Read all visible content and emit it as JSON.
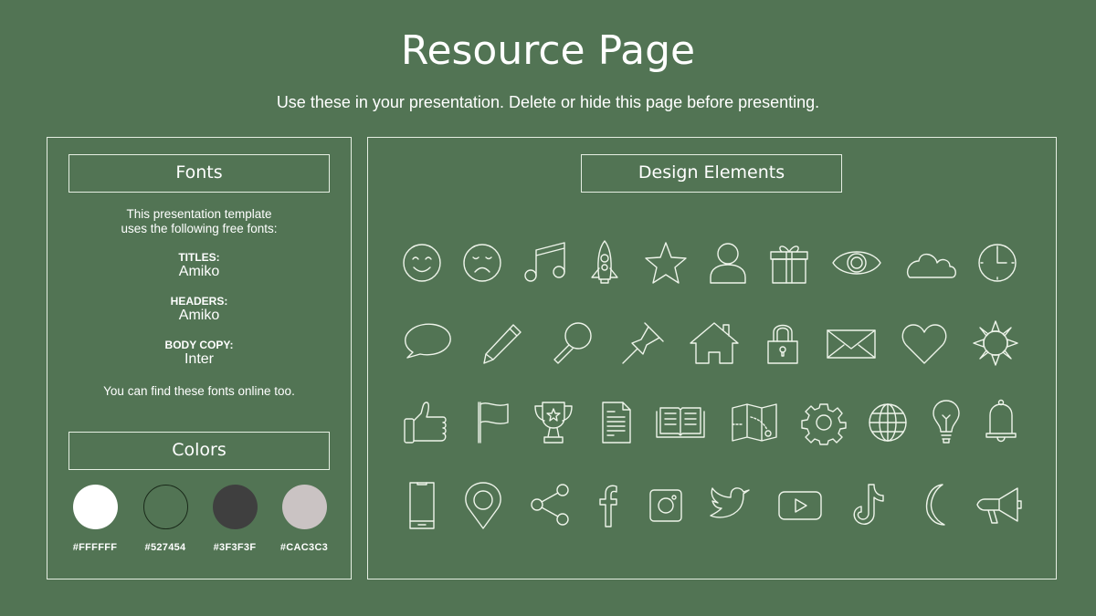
{
  "header": {
    "title": "Resource Page",
    "subtitle": "Use these in your presentation. Delete or hide this page before presenting."
  },
  "fonts_panel": {
    "heading": "Fonts",
    "intro_line1": "This presentation template",
    "intro_line2": "uses the following free fonts:",
    "entries": [
      {
        "label": "TITLES:",
        "value": "Amiko"
      },
      {
        "label": "HEADERS:",
        "value": "Amiko"
      },
      {
        "label": "BODY COPY:",
        "value": "Inter"
      }
    ],
    "footer": "You can find these fonts online too."
  },
  "colors_panel": {
    "heading": "Colors",
    "swatches": [
      {
        "hex": "#FFFFFF",
        "color": "#FFFFFF"
      },
      {
        "hex": "#527454",
        "color": "#527454"
      },
      {
        "hex": "#3F3F3F",
        "color": "#3F3F3F"
      },
      {
        "hex": "#CAC3C3",
        "color": "#CAC3C3"
      }
    ]
  },
  "design_panel": {
    "heading": "Design Elements",
    "icons": [
      [
        "smiley-face",
        "sad-face",
        "music-note",
        "rocket",
        "star",
        "user",
        "gift",
        "eye",
        "cloud",
        "clock"
      ],
      [
        "speech-bubble",
        "pencil",
        "magnifying-glass",
        "push-pin",
        "house",
        "padlock",
        "envelope",
        "heart",
        "sun"
      ],
      [
        "thumbs-up",
        "flag",
        "trophy",
        "document",
        "open-book",
        "map",
        "gear",
        "globe",
        "light-bulb",
        "bell"
      ],
      [
        "smartphone",
        "location-pin",
        "share",
        "facebook",
        "instagram",
        "twitter",
        "youtube",
        "tiktok",
        "crescent-moon",
        "megaphone"
      ]
    ]
  }
}
